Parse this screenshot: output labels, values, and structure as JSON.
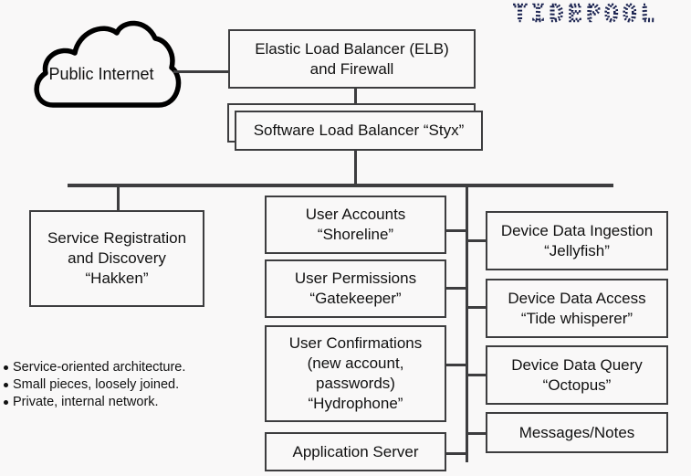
{
  "logo": {
    "text": "TIDEPOOL",
    "color": "#1c2451"
  },
  "cloud": {
    "label": "Public Internet"
  },
  "elb": {
    "lines": [
      "Elastic Load Balancer (ELB)",
      "and Firewall"
    ]
  },
  "styx": {
    "label": "Software Load Balancer “Styx”"
  },
  "hakken": {
    "lines": [
      "Service Registration",
      "and Discovery",
      "“Hakken”"
    ]
  },
  "middle_services": [
    {
      "lines": [
        "User Accounts",
        "“Shoreline”"
      ]
    },
    {
      "lines": [
        "User Permissions",
        "“Gatekeeper”"
      ]
    },
    {
      "lines": [
        "User Confirmations",
        "(new account,",
        "passwords)",
        "“Hydrophone”"
      ]
    },
    {
      "lines": [
        "Application Server"
      ]
    }
  ],
  "right_services": [
    {
      "lines": [
        "Device Data Ingestion",
        "“Jellyfish”"
      ]
    },
    {
      "lines": [
        "Device Data Access",
        "“Tide whisperer”"
      ]
    },
    {
      "lines": [
        "Device Data Query",
        "“Octopus”"
      ]
    },
    {
      "lines": [
        "Messages/Notes"
      ]
    }
  ],
  "notes": [
    "Service-oriented architecture.",
    "Small pieces, loosely joined.",
    "Private, internal network."
  ],
  "colors": {
    "line": "#3d3d3f",
    "background": "#f9f8f8",
    "text": "#111111"
  }
}
